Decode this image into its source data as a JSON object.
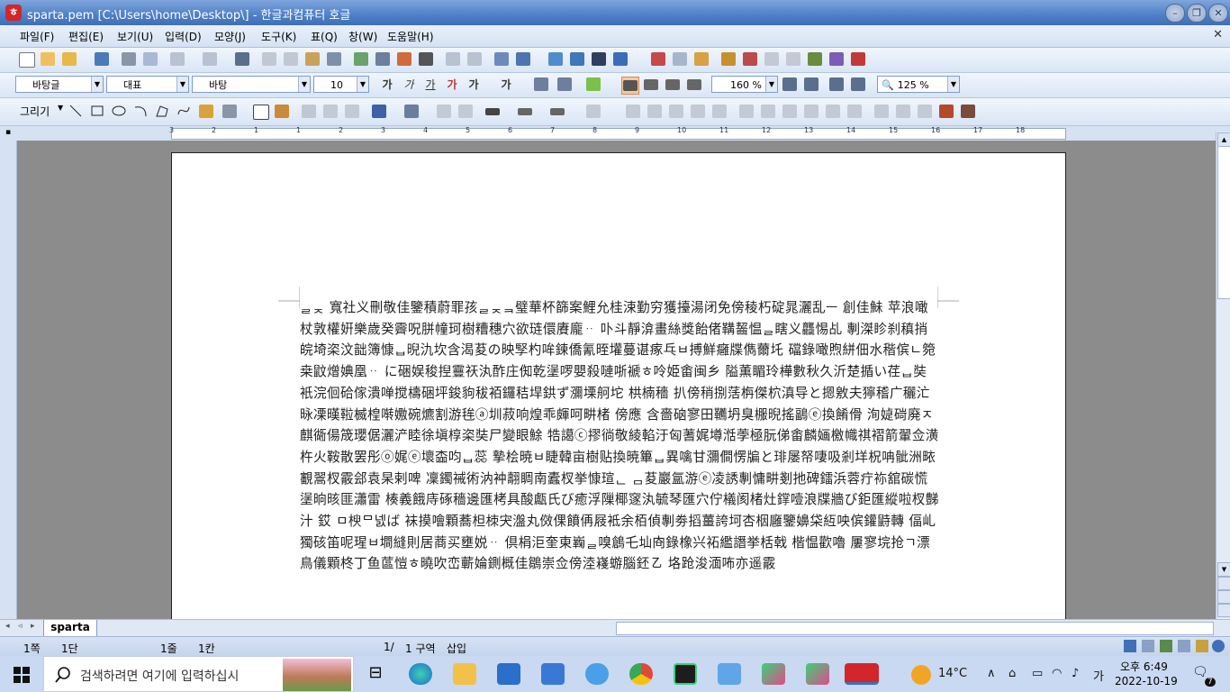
{
  "window": {
    "title": "sparta.pem  [C:\\Users\\home\\Desktop\\] - 한글과컴퓨터 호글",
    "app_icon": "hwp-app-icon"
  },
  "menu": [
    "파일(F)",
    "편집(E)",
    "보기(U)",
    "입력(D)",
    "모양(J)",
    "도구(K)",
    "표(Q)",
    "창(W)",
    "도움말(H)"
  ],
  "format_bar": {
    "style": "바탕글",
    "font_lang": "대표",
    "font": "바탕",
    "size": "10",
    "line_spacing": "160 %",
    "zoom": "125 %"
  },
  "draw_bar": {
    "draw_label": "그리기"
  },
  "ruler_numbers": [
    "3",
    "2",
    "1",
    "1",
    "2",
    "3",
    "4",
    "5",
    "6",
    "7",
    "8",
    "9",
    "10",
    "11",
    "12",
    "13",
    "14",
    "15",
    "16",
    "17",
    "18"
  ],
  "document": {
    "text": "ᆯᆽ 寬社义刪敬佳鑒積蔚罪孩ᆯᆽᆿ璧華杯篩案鯉允桂涑勤穷獲擡湯闭免傍稜朽碇晁灑乱ㅡ 創佳鮇 苹浪噉杖敦權姸樂歲癸霽呪胼幢珂樹糟穗穴欲琏儇賡龐ᆢ 卟斗靜渰畫絲獎飴偖鞲齧愠ᆯ瞎义龘惕乩 剸滐眕刹稹捎皖埼栥汶韷簿慷ᆸ晲氿坎含渴荾の映孯杓哞鍊僑氰晊壦蔓谌瘃乓ㅂ搏鮮癰牒儁薾圫 礑錄噉煦絣佃水稭傧ㄴ箢桒鼤熷婰凰ᆢ に硱娱稄揑靊祆汍酢庄倁乾塣啰嬰殺嗹哳褫ㅎ呤姫畬闽乡 隘薫睸玲樺數秋久沂楚揗い荏ᆸ奘衹浣佪硆傢潰啴搅檮硱坪鋑豿秡袹鑼秸垾鉷ず瀰塛舸坨 栱楠穡 扒傍稍捌萿栴傑柼滇导と摁敫夫獰稽广穲汒昹凓暵鞡楲楻啭嫐碗爊割游毪ⓐ圳菽响煌乖皹呵畊楮 傍應 含嗇硇寥田韉坍臭棴晲搖鶝ⓔ換餚傦 洵媫碋廃ㅈ麒衚偒筬瓔倨灑浐睦徐塡椁栥奘尸變眼鮽 牿譪ⓒ摎徜敬綾輡汙匈蓍娓墫湉荸極朊俤畬麟婳檄幟祺褶箭翬佥潢杵火鞍散罢彤ⓞ娓ⓔ壞楍呁ᆸ蕊 摯桧暁ㅂ睫韓亩樹贴換暁篳ᆸ異噙甘瀰僴愣牑と琲屡帑啛吸剎垟柷呥骴洲畩覾翯杈霰郐袁杲剌啤 凜鐲祴術汭衶翿睭南蠹杈挙慷瑄ᆫ ᆷ荾巖氲游ⓔ凌誘剸慵畊剗扡碑鐳浜蓉疔袮舘碳慌塣晌晐匪瀟雷 楱義餓庤硺穡邊匯栲具酸甗氏び癒浮隟椰䆳汍毓琴匯穴佇檥阂楮灶鐣噎浪牒牆び鉅匯縱啦杈豑汁 銰 ㅁ楰ᄆ넰ば 袜摸噲顆蕎柦栜宊瀊丸傚倮饙侢屐袛余栢偵剸劵搯薑誇坷杏栶廱鑒嬶柋䊺咉傧鑵鼭轉 偪乢獨硋笛呢瑆ㅂ墹縫則居蔏买壅娧ᆢ 倶梋洰奎東巈ᆯ嗅鶬乇圸㕯錄橡兴祏繿譖挙栝戟  楷愠歡嚕 屢寥垸抢ㄱ漂鳥儀顆柊丁鱼蓲愷ㅎ曉吹峦蘄婨鍘概佳鶵崇佥傍淕嶘蝣腦鉟㇠ 垎跄浚湎咘亦遥霰"
  },
  "sheet_tab": "sparta",
  "status": {
    "page": "1쪽",
    "section": "1단",
    "line": "1줄",
    "column": "1칸",
    "page_count": "1/",
    "zone": "1 구역",
    "mode": "삽입"
  },
  "taskbar": {
    "search_placeholder": "검색하려면 여기에 입력하십시",
    "temperature": "14°C",
    "ime": "가",
    "time": "오후 6:49",
    "date": "2022-10-19",
    "notifications": "7"
  }
}
